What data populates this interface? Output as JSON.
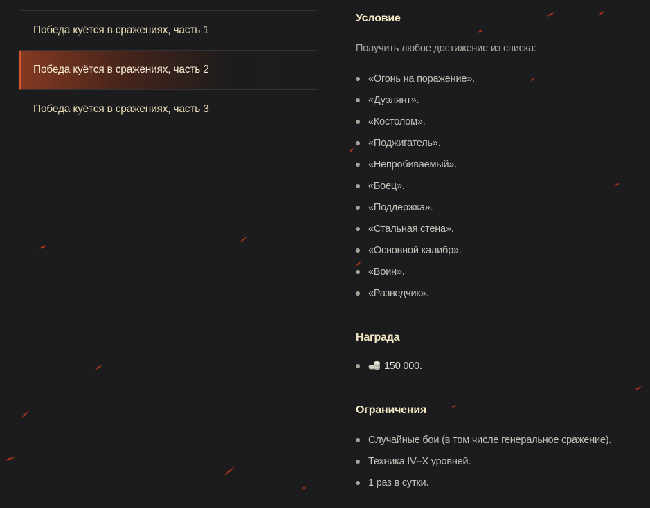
{
  "nav": {
    "items": [
      {
        "label": "Победа куётся в сражениях, часть 1",
        "active": false
      },
      {
        "label": "Победа куётся в сражениях, часть 2",
        "active": true
      },
      {
        "label": "Победа куётся в сражениях, часть 3",
        "active": false
      }
    ]
  },
  "condition": {
    "title": "Условие",
    "intro": "Получить любое достижение из списка:",
    "items": [
      "«Огонь на поражение».",
      "«Дуэлянт».",
      "«Костолом».",
      "«Поджигатель».",
      "«Непробиваемый».",
      "«Боец».",
      "«Поддержка».",
      "«Стальная стена».",
      "«Основной калибр».",
      "«Воин».",
      "«Разведчик»."
    ]
  },
  "reward": {
    "title": "Награда",
    "icon": "credits-icon",
    "amount": "150 000."
  },
  "limits": {
    "title": "Ограничения",
    "items": [
      "Случайные бои (в том числе генеральное сражение).",
      "Техника IV–X уровней.",
      "1 раз в сутки."
    ]
  },
  "colors": {
    "background": "#1c1c1e",
    "accent": "#d8552e",
    "title": "#f3e7c4",
    "text": "#c3c2b8"
  }
}
